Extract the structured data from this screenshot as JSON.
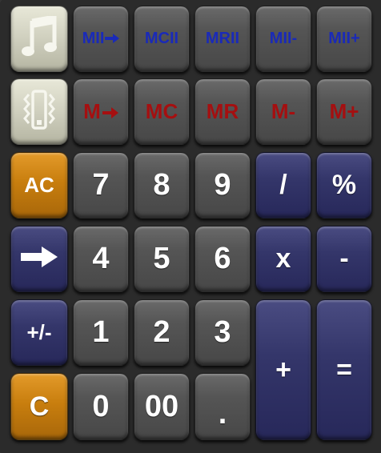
{
  "memory_row_2": {
    "m2_store": "MII",
    "m2_clear": "MCII",
    "m2_recall": "MRII",
    "m2_minus": "MII-",
    "m2_plus": "MII+"
  },
  "memory_row_1": {
    "m_store": "M",
    "m_clear": "MC",
    "m_recall": "MR",
    "m_minus": "M-",
    "m_plus": "M+"
  },
  "keys": {
    "ac": "AC",
    "seven": "7",
    "eight": "8",
    "nine": "9",
    "divide": "/",
    "percent": "%",
    "four": "4",
    "five": "5",
    "six": "6",
    "multiply": "x",
    "subtract": "-",
    "sign": "+/-",
    "one": "1",
    "two": "2",
    "three": "3",
    "add": "+",
    "equals": "=",
    "clear": "C",
    "zero": "0",
    "double_zero": "00",
    "decimal": "."
  },
  "icons": {
    "sound": "music-note-icon",
    "vibrate": "vibrate-phone-icon",
    "backspace": "arrow-right-icon"
  },
  "colors": {
    "memory_blue": "#1a2ab8",
    "memory_red": "#a50f10",
    "orange_key": "#c87e0e",
    "navy_key": "#34366a",
    "gray_key": "#555555",
    "beige_key": "#cfcfbe"
  }
}
